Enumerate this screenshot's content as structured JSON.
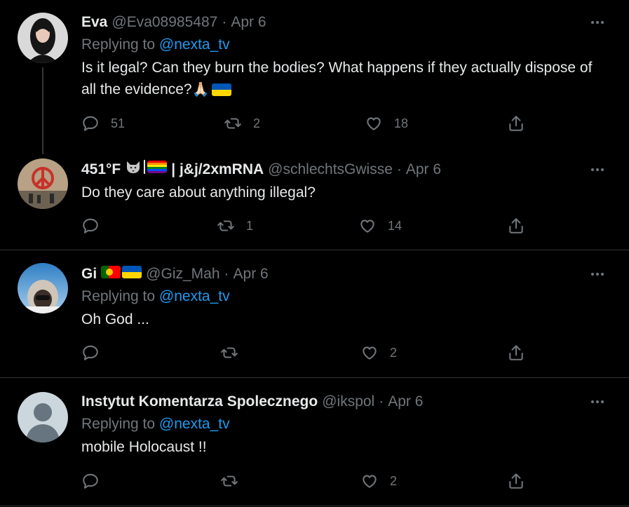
{
  "tweets": [
    {
      "name": "Eva",
      "handle": "@Eva08985487",
      "dot": "·",
      "date": "Apr 6",
      "replying_prefix": "Replying to ",
      "replying_to": "@nexta_tv",
      "text": "Is it legal? Can they burn the bodies? What happens if they actually dispose of all the evidence?",
      "text_emoji": "🙏🏻",
      "reply_count": "51",
      "retweet_count": "2",
      "like_count": "18"
    },
    {
      "name_part1": "451°F",
      "name_part2": "| j&j/2xmRNA",
      "handle": "@schlechtsGwisse",
      "dot": "·",
      "date": "Apr 6",
      "text": "Do they care about anything illegal?",
      "reply_count": "",
      "retweet_count": "1",
      "like_count": "14"
    },
    {
      "name": "Gi",
      "handle": "@Giz_Mah",
      "dot": "·",
      "date": "Apr 6",
      "replying_prefix": "Replying to ",
      "replying_to": "@nexta_tv",
      "text": "Oh God ...",
      "reply_count": "",
      "retweet_count": "",
      "like_count": "2"
    },
    {
      "name": "Instytut Komentarza Spolecznego",
      "handle": "@ikspol",
      "dot": "·",
      "date": "Apr 6",
      "replying_prefix": "Replying to ",
      "replying_to": "@nexta_tv",
      "text": "mobile Holocaust !!",
      "reply_count": "",
      "retweet_count": "",
      "like_count": "2"
    }
  ],
  "colors": {
    "background": "#000000",
    "text": "#e7e9ea",
    "muted": "#71767b",
    "link": "#1d9bf0",
    "divider": "#2f3336"
  },
  "icons": [
    "reply-icon",
    "retweet-icon",
    "like-icon",
    "share-icon",
    "more-icon"
  ]
}
